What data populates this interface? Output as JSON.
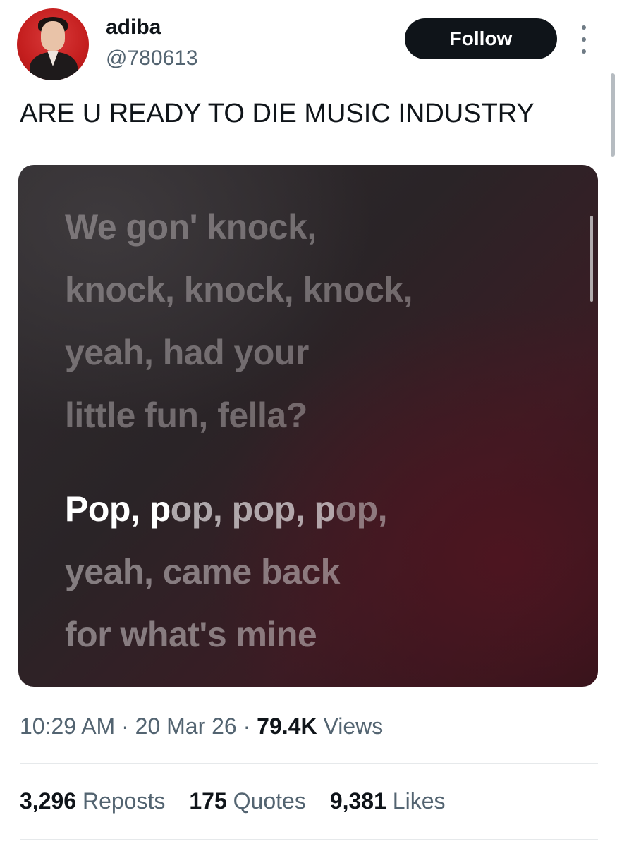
{
  "user": {
    "display_name": "adiba",
    "handle": "@780613",
    "follow_label": "Follow",
    "more_icon": "more-vertical-icon"
  },
  "tweet": {
    "text": "ARE U READY TO DIE MUSIC INDUSTRY"
  },
  "media": {
    "previous_lyric_lines": [
      "We gon' knock,",
      "knock, knock, knock,",
      "yeah, had your",
      "little fun, fella?"
    ],
    "current_line_1": {
      "sung": "Pop, p",
      "partial": "op, pop, p",
      "unsung": "op,"
    },
    "current_lyric_lines": [
      "yeah, came back",
      "for what's mine"
    ]
  },
  "meta": {
    "time": "10:29 AM",
    "separator": " · ",
    "date": "20 Mar 26",
    "views_count": "79.4K",
    "views_label": "Views"
  },
  "stats": {
    "reposts_count": "3,296",
    "reposts_label": "Reposts",
    "quotes_count": "175",
    "quotes_label": "Quotes",
    "likes_count": "9,381",
    "likes_label": "Likes"
  }
}
